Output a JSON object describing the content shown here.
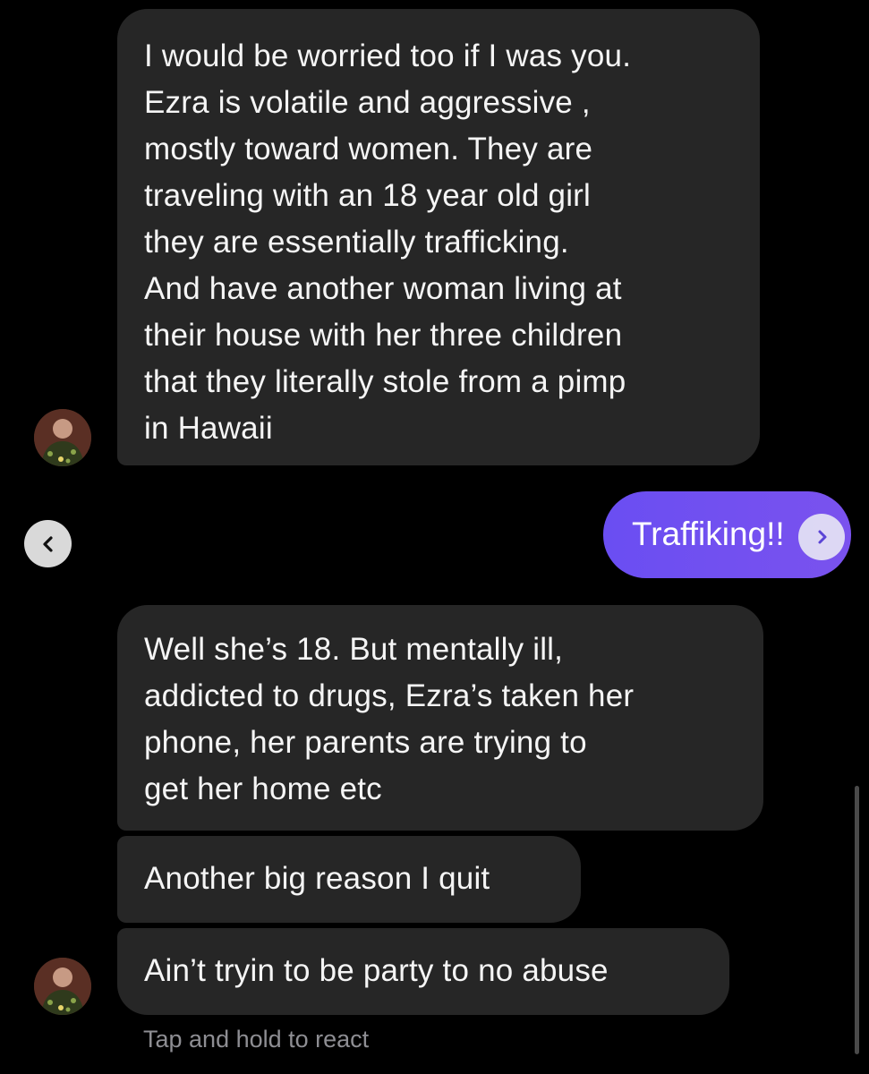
{
  "messages": [
    {
      "sender": "them",
      "text": "I would be worried too if I was you.\nEzra is volatile and aggressive ,\nmostly toward women. They are\ntraveling with an 18 year old girl\nthey are essentially trafficking.\nAnd have another woman living at\ntheir house with her three children\nthat they literally stole from a pimp\nin Hawaii"
    },
    {
      "sender": "me",
      "text": "Traffiking!!"
    },
    {
      "sender": "them",
      "text": "Well she’s 18. But mentally ill,\naddicted to drugs, Ezra’s taken her\nphone, her parents are trying to\nget her home etc"
    },
    {
      "sender": "them",
      "text": "Another big reason I quit"
    },
    {
      "sender": "them",
      "text": "Ain’t tryin to be party to no abuse"
    }
  ],
  "hint": "Tap and hold to react",
  "icons": {
    "back": "chevron-left-icon",
    "reply": "reply-arrow-icon",
    "avatar": "user-avatar"
  },
  "colors": {
    "background": "#000000",
    "incoming_bubble": "#262626",
    "outgoing_bubble": "#6e4ff0",
    "hint_text": "#8e8e93"
  }
}
